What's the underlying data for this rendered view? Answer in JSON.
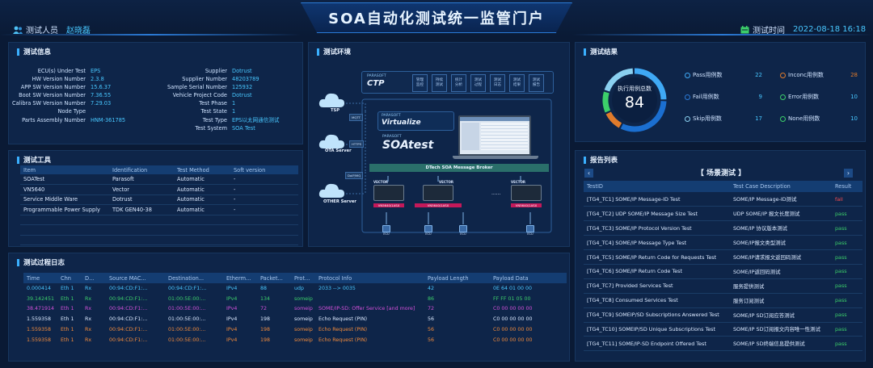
{
  "header": {
    "title": "SOA自动化测试统一监管门户",
    "tester_label": "测试人员",
    "tester_name": "赵晓磊",
    "time_label": "测试时间",
    "time_value": "2022-08-18 16:18"
  },
  "test_info": {
    "title": "测试信息",
    "left": [
      [
        "ECU(s) Under Test",
        "EPS"
      ],
      [
        "HW Version Number",
        "2.3.8"
      ],
      [
        "APP SW Version Number",
        "15.6.37"
      ],
      [
        "Boot SW Version Number",
        "7.36.55"
      ],
      [
        "Calibra SW Version Number",
        "7.29.03"
      ],
      [
        "Node Type",
        ""
      ],
      [
        "Parts Assembly Number",
        "HNM-361785"
      ]
    ],
    "right": [
      [
        "Supplier",
        "Dotrust"
      ],
      [
        "Supplier Number",
        "48203789"
      ],
      [
        "Sample Serial Number",
        "125932"
      ],
      [
        "Vehicle Project Code",
        "Dotrust"
      ],
      [
        "Test Phase",
        "1"
      ],
      [
        "Test State",
        "1"
      ],
      [
        "Test Type",
        "EPS以太网通信测试"
      ],
      [
        "Test System",
        "SOA Test"
      ]
    ]
  },
  "tools": {
    "title": "测试工具",
    "headers": [
      "Item",
      "Identification",
      "Test Method",
      "Soft version"
    ],
    "rows": [
      [
        "SOATest",
        "Parasoft",
        "Automatic",
        "-"
      ],
      [
        "VN5640",
        "Vector",
        "Automatic",
        "-"
      ],
      [
        "Service Middle Ware",
        "Dotrust",
        "Automatic",
        "-"
      ],
      [
        "Programmable Power Supply",
        "TDK GEN40-38",
        "Automatic",
        "-"
      ]
    ]
  },
  "env": {
    "title": "测试环境",
    "tsp": "TSP",
    "ota": "OTA Server",
    "other": "OTHER Server",
    "mqtt": "MQTT",
    "https": "HTTPS",
    "diag": "DoIP/MQ",
    "ctp_brand": "PARASOFT",
    "ctp": "CTP",
    "ctp_cells": [
      "管理\n监控",
      "持续\n测试",
      "统计\n分析",
      "测试\n过程",
      "测试\n日志",
      "测试\n结果",
      "测试\n报告"
    ],
    "virt_brand": "PARASOFT",
    "virtualize": "Virtualize",
    "soatest_brand": "PARASOFT",
    "soatest": "SOAtest",
    "broker": "DTech SOA Message Broker",
    "vector": "VECTOR",
    "vn": "VN5640/1ASX",
    "vn2": "VN5640/1ASX",
    "vn3": "VN5640/1ASX",
    "dots": "......",
    "ecu": "ECU"
  },
  "results": {
    "title": "测试结果",
    "total_label": "执行用例总数",
    "total": "84",
    "items": [
      {
        "label": "Pass用例数",
        "value": "22",
        "color": "#3fa9f5"
      },
      {
        "label": "Inconc用例数",
        "value": "28",
        "color": "#e07b2b"
      },
      {
        "label": "Fail用例数",
        "value": "9",
        "color": "#2b7ad6"
      },
      {
        "label": "Error用例数",
        "value": "10",
        "color": "#3ccf6a"
      },
      {
        "label": "Skip用例数",
        "value": "17",
        "color": "#8ad0f0"
      },
      {
        "label": "None用例数",
        "value": "10",
        "color": "#3ccf6a"
      }
    ],
    "ring": [
      {
        "value": 22,
        "color": "#3fa9f5"
      },
      {
        "value": 28,
        "color": "#1b6fd1"
      },
      {
        "value": 9,
        "color": "#e07b2b"
      },
      {
        "value": 10,
        "color": "#3ccf6a"
      },
      {
        "value": 17,
        "color": "#8ad0f0"
      }
    ]
  },
  "report": {
    "title": "报告列表",
    "scene": "【 场景测试 】",
    "headers": [
      "TestID",
      "Test Case Description",
      "Result"
    ],
    "rows": [
      [
        "[TG4_TC1] SOME/IP Message-ID Test",
        "SOME/IP Message-ID测试",
        "fail"
      ],
      [
        "[TG4_TC2] UDP SOME/IP Message Size Test",
        "UDP SOME/IP 报文长度测试",
        "pass"
      ],
      [
        "[TG4_TC3] SOME/IP Protocol Version Test",
        "SOME/IP 协议版本测试",
        "pass"
      ],
      [
        "[TG4_TC4] SOME/IP Message Type Test",
        "SOME/IP报文类型测试",
        "pass"
      ],
      [
        "[TG4_TC5] SOME/IP Return Code for Requests Test",
        "SOME/IP请求报文返回码测试",
        "pass"
      ],
      [
        "[TG4_TC6] SOME/IP Return Code Test",
        "SOME/IP返回码测试",
        "pass"
      ],
      [
        "[TG4_TC7] Provided Services Test",
        "服务提供测试",
        "pass"
      ],
      [
        "[TG4_TC8] Consumed Services Test",
        "服务订阅测试",
        "pass"
      ],
      [
        "[TG4_TC9] SOMEIP/SD Subscriptions Answered Test",
        "SOME/IP SD订阅应答测试",
        "pass"
      ],
      [
        "[TG4_TC10] SOMEIP/SD Unique Subscriptions Test",
        "SOME/IP SD订阅报文内容唯一性测试",
        "pass"
      ],
      [
        "[TG4_TC11] SOME/IP-SD Endpoint Offered Test",
        "SOME/IP SD终端信息提供测试",
        "pass"
      ]
    ]
  },
  "log": {
    "title": "测试过程日志",
    "headers": [
      "Time",
      "Chn",
      "D...",
      "Source MAC...",
      "Destination...",
      "Etherm...",
      "Packet...",
      "Prot...",
      "Protocol Info",
      "Payload Length",
      "Payload Data"
    ],
    "rows": [
      [
        "0.000414",
        "Eth 1",
        "Rx",
        "00:94:CD:F1:...",
        "00:94:CD:F1:...",
        "IPv4",
        "88",
        "udp",
        "2033 --> 0035",
        "42",
        "0E 64 01 00 00",
        "#48c7ff"
      ],
      [
        "39.142451",
        "Eth 1",
        "Rx",
        "00:94:CD:F1:...",
        "01:00:5E:00:...",
        "IPv4",
        "134",
        "someip",
        "",
        "86",
        "FF FF 01 05 00",
        "#3ccf6a"
      ],
      [
        "38.471914",
        "Eth 1",
        "Rx",
        "00:94:CD:F1:...",
        "01:00:5E:00:...",
        "IPv4",
        "72",
        "someip",
        "SOME/IP-SD: Offer Service [and more]",
        "72",
        "C0 00 00 00 00",
        "#d24fd8"
      ],
      [
        "1.559358",
        "Eth 1",
        "Rx",
        "00:94:CD:F1:...",
        "01:00:5E:00:...",
        "IPv4",
        "198",
        "someip",
        "Echo Request (PIN)",
        "56",
        "C0 00 00 00 00",
        "#dbe9ff"
      ],
      [
        "1.559358",
        "Eth 1",
        "Rx",
        "00:94:CD:F1:...",
        "01:00:5E:00:...",
        "IPv4",
        "198",
        "someip",
        "Echo Request (PIN)",
        "56",
        "C0 00 00 00 00",
        "#f08a3c"
      ],
      [
        "1.559358",
        "Eth 1",
        "Rx",
        "00:94:CD:F1:...",
        "01:00:5E:00:...",
        "IPv4",
        "198",
        "someip",
        "Echo Request (PIN)",
        "56",
        "C0 00 00 00 00",
        "#f08a3c"
      ]
    ]
  }
}
